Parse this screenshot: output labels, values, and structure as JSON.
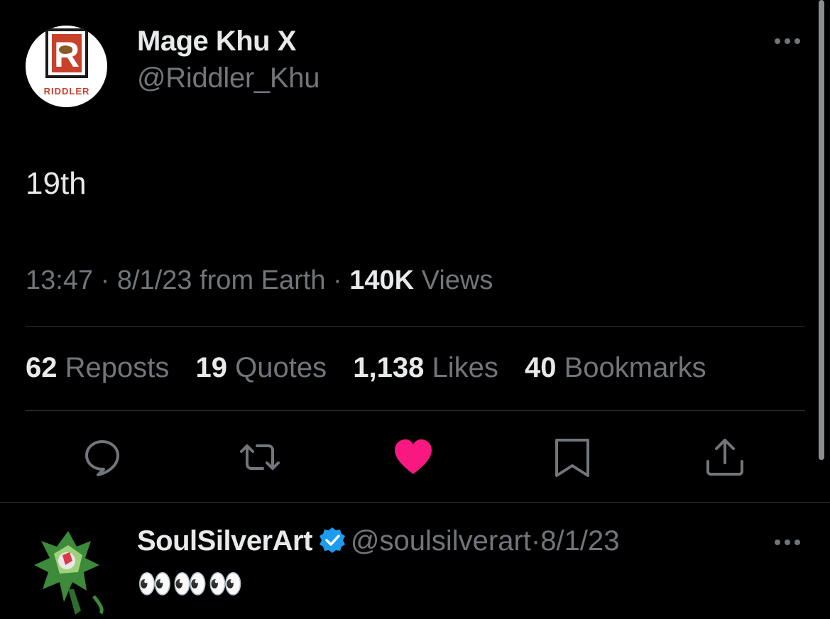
{
  "tweet": {
    "author_name": "Mage Khu X",
    "author_handle": "@Riddler_Khu",
    "avatar_logo_text": "RIDDLER",
    "avatar_letter": "R",
    "text": "19th",
    "time": "13:47",
    "date": "8/1/23",
    "from_label": "from Earth",
    "separator": "·",
    "views_count": "140K",
    "views_label": "Views"
  },
  "stats": {
    "reposts": {
      "count": "62",
      "label": "Reposts"
    },
    "quotes": {
      "count": "19",
      "label": "Quotes"
    },
    "likes": {
      "count": "1,138",
      "label": "Likes"
    },
    "bookmarks": {
      "count": "40",
      "label": "Bookmarks"
    }
  },
  "actions": [
    {
      "icon": "reply-icon"
    },
    {
      "icon": "repost-icon"
    },
    {
      "icon": "like-icon",
      "active": true,
      "color": "#f91880"
    },
    {
      "icon": "bookmark-icon"
    },
    {
      "icon": "share-icon"
    }
  ],
  "reply": {
    "author_name": "SoulSilverArt",
    "author_handle": "@soulsilverart",
    "separator": "·",
    "date": "8/1/23",
    "verified": true,
    "text": "👀👀👀"
  },
  "colors": {
    "background": "#000000",
    "primary_text": "#e7e9ea",
    "secondary_text": "#71767b",
    "divider": "#2f3336",
    "like": "#f91880",
    "verified": "#1d9bf0"
  }
}
